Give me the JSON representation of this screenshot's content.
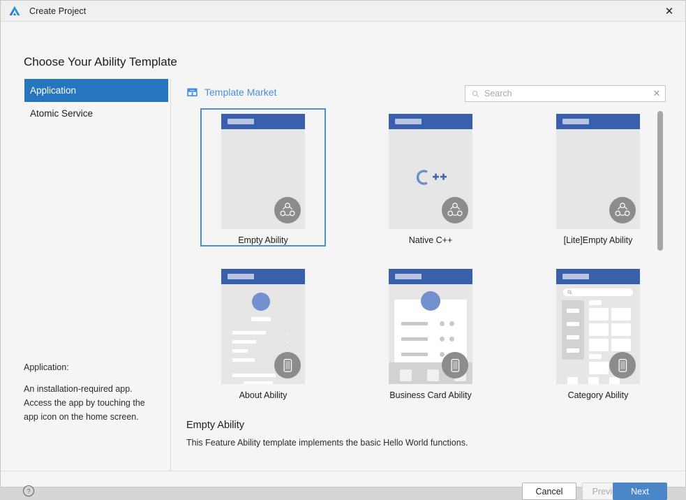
{
  "window": {
    "title": "Create Project",
    "logo_icon": "deveco-triangle-logo",
    "close_icon": "close-icon"
  },
  "heading": "Choose Your Ability Template",
  "sidebar": {
    "items": [
      {
        "label": "Application",
        "selected": true
      },
      {
        "label": "Atomic Service",
        "selected": false
      }
    ],
    "description": {
      "title": "Application:",
      "lines": [
        "An installation-required app.",
        "Access the app by touching the",
        "app icon on the home screen."
      ]
    }
  },
  "market": {
    "label": "Template Market",
    "icon": "storefront-icon"
  },
  "search": {
    "placeholder": "Search",
    "value": "",
    "icon": "search-icon",
    "clear_icon": "clear-icon"
  },
  "templates": [
    {
      "label": "Empty Ability",
      "selected": true,
      "badge": "distributed-ability-icon"
    },
    {
      "label": "Native C++",
      "selected": false,
      "badge": "distributed-ability-icon",
      "glyph": "C++"
    },
    {
      "label": "[Lite]Empty Ability",
      "selected": false,
      "badge": "distributed-ability-icon"
    },
    {
      "label": "About Ability",
      "selected": false,
      "badge": "phone-device-icon"
    },
    {
      "label": "Business Card Ability",
      "selected": false,
      "badge": "phone-device-icon"
    },
    {
      "label": "Category Ability",
      "selected": false,
      "badge": "phone-device-icon"
    }
  ],
  "detail": {
    "title": "Empty Ability",
    "description": "This Feature Ability template implements the basic Hello World functions."
  },
  "footer": {
    "help_icon": "help-circle-icon",
    "cancel": "Cancel",
    "previous": "Previous",
    "next": "Next"
  },
  "colors": {
    "accent": "#2675bf",
    "selection_border": "#4a90d9",
    "primary_button": "#4a86c8",
    "link": "#4b8fdc",
    "thumb_topbar": "#3a5fad"
  },
  "scrollbar": {
    "position_percent": 1
  }
}
